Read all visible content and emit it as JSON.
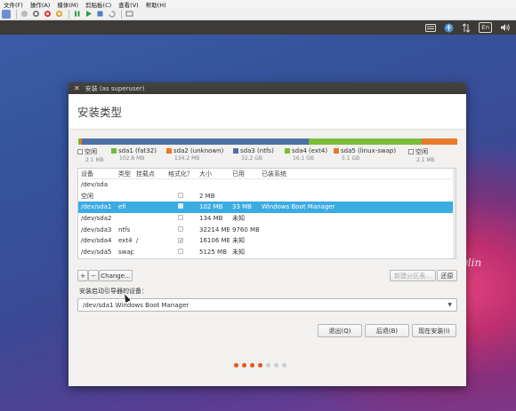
{
  "vm": {
    "menu": [
      "文件(F)",
      "操作(A)",
      "媒体(M)",
      "剪贴板(C)",
      "查看(V)",
      "帮助(H)"
    ]
  },
  "panel": {
    "lang": "En"
  },
  "desktop": {
    "text": "ylin"
  },
  "dialog": {
    "title": "安装 (as superuser)",
    "heading": "安装类型",
    "partitions": [
      {
        "label": "空闲",
        "size": "2.1 MB",
        "color": "#ffffff"
      },
      {
        "label": "sda1 (fat32)",
        "size": "102.8 MB",
        "color": "#6abf2f"
      },
      {
        "label": "sda2 (unknown)",
        "size": "134.2 MB",
        "color": "#e8782a"
      },
      {
        "label": "sda3 (ntfs)",
        "size": "32.2 GB",
        "color": "#4f6fa8"
      },
      {
        "label": "sda4 (ext4)",
        "size": "16.1 GB",
        "color": "#7dbb3a"
      },
      {
        "label": "sda5 (linux-swap)",
        "size": "5.1 GB",
        "color": "#e8782a"
      },
      {
        "label": "空闲",
        "size": "2.1 MB",
        "color": "#ffffff"
      }
    ],
    "table": {
      "headers": [
        "设备",
        "类型",
        "挂载点",
        "格式化？",
        "大小",
        "已用",
        "已装系统"
      ],
      "rows": [
        {
          "device": "/dev/sda",
          "type": "",
          "mount": "",
          "format": "",
          "size": "",
          "used": "",
          "system": ""
        },
        {
          "device": "空闲",
          "type": "",
          "mount": "",
          "format": "box",
          "size": "2 MB",
          "used": "",
          "system": ""
        },
        {
          "device": "/dev/sda1",
          "type": "efi",
          "mount": "",
          "format": "box",
          "size": "102 MB",
          "used": "33 MB",
          "system": "Windows Boot Manager"
        },
        {
          "device": "/dev/sda2",
          "type": "",
          "mount": "",
          "format": "box",
          "size": "134 MB",
          "used": "未知",
          "system": ""
        },
        {
          "device": "/dev/sda3",
          "type": "ntfs",
          "mount": "",
          "format": "box",
          "size": "32214 MB",
          "used": "9760 MB",
          "system": ""
        },
        {
          "device": "/dev/sda4",
          "type": "ext4",
          "mount": "/",
          "format": "checked",
          "size": "16106 MB",
          "used": "未知",
          "system": ""
        },
        {
          "device": "/dev/sda5",
          "type": "swap",
          "mount": "",
          "format": "box",
          "size": "5125 MB",
          "used": "未知",
          "system": ""
        }
      ],
      "selected_index": 2
    },
    "buttons": {
      "add": "+",
      "remove": "−",
      "change": "Change...",
      "new_table": "新建分区表...",
      "revert": "还原",
      "quit": "退出(Q)",
      "back": "后退(B)",
      "install": "现在安装(I)"
    },
    "boot_loader_label": "安装启动引导器的设备：",
    "boot_loader_value": "/dev/sda1   Windows Boot Manager",
    "progress": {
      "total": 7,
      "completed": 4,
      "active_color": "#e95420",
      "inactive_color": "#cccccc"
    }
  }
}
